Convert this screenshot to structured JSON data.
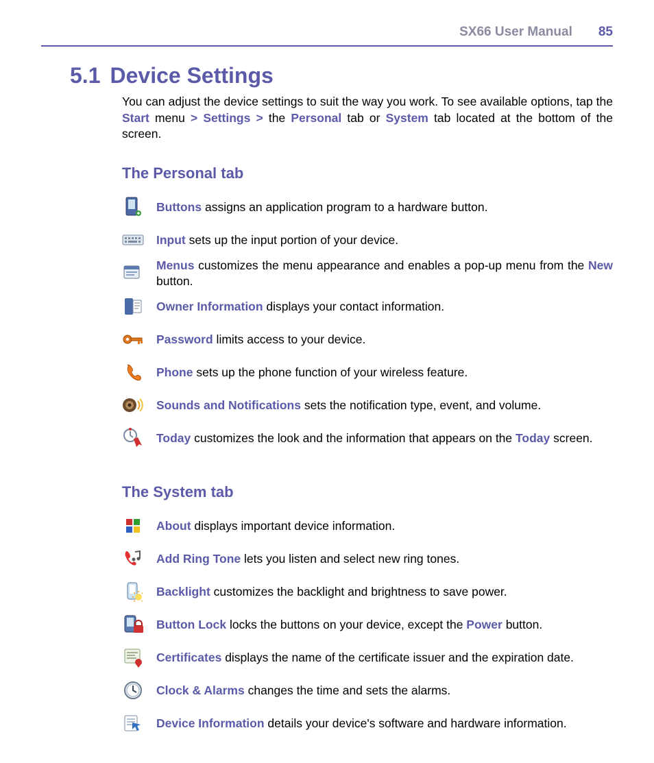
{
  "header": {
    "manual_title": "SX66 User Manual",
    "page_number": "85"
  },
  "section": {
    "number": "5.1",
    "title": "Device Settings"
  },
  "intro": {
    "pre": "You can adjust the device settings to suit the way you work. To see available options, tap the ",
    "k1": "Start",
    "t1": " menu ",
    "k2": "> Settings >",
    "t2": " the ",
    "k3": "Personal",
    "t3": " tab or ",
    "k4": "System",
    "t4": " tab located at the bottom of the screen."
  },
  "personal": {
    "heading": "The Personal tab",
    "items": {
      "buttons": {
        "label": "Buttons",
        "desc": " assigns an application program to a hardware button."
      },
      "input": {
        "label": "Input",
        "desc": " sets up the input portion of your device."
      },
      "menus": {
        "label": "Menus",
        "mid": " customizes the menu appearance and enables a pop-up menu from the ",
        "k": "New",
        "tail": " button."
      },
      "owner": {
        "label": "Owner Information",
        "desc": " displays your contact information."
      },
      "password": {
        "label": "Password",
        "desc": " limits access to your device."
      },
      "phone": {
        "label": "Phone",
        "desc": " sets up the phone function of your wireless feature."
      },
      "sounds": {
        "label": "Sounds and Notifications",
        "desc": " sets the notification type, event, and volume."
      },
      "today": {
        "label": "Today",
        "mid": " customizes the look and the information that appears on the ",
        "k": "Today",
        "tail": " screen."
      }
    }
  },
  "system": {
    "heading": "The System tab",
    "items": {
      "about": {
        "label": "About",
        "desc": " displays important device information."
      },
      "ringtone": {
        "label": "Add Ring Tone",
        "desc": " lets you listen and select new ring tones."
      },
      "backlight": {
        "label": "Backlight",
        "desc": " customizes the backlight and brightness to save power."
      },
      "buttonlock": {
        "label": "Button Lock",
        "mid": " locks the buttons on your device, except the ",
        "k": "Power",
        "tail": " button."
      },
      "certificates": {
        "label": "Certificates",
        "desc": " displays the name of the certificate issuer and the expiration date."
      },
      "clock": {
        "label": "Clock & Alarms",
        "desc": " changes the time and sets the alarms."
      },
      "deviceinfo": {
        "label": "Device Information",
        "desc": " details your device's software and hardware information."
      }
    }
  }
}
